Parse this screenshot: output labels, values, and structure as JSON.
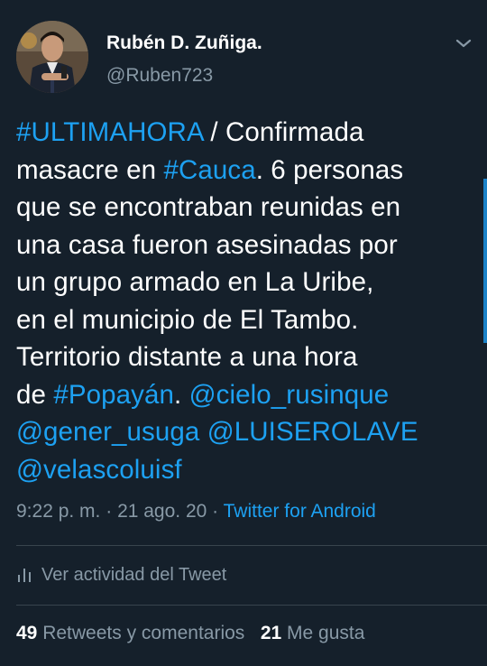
{
  "author": {
    "display_name": "Rubén D. Zuñiga.",
    "handle": "@Ruben723",
    "avatar_icon": "profile-photo"
  },
  "menu_icon": "chevron-down-icon",
  "tweet": {
    "lines": [
      [
        {
          "text": "#ULTIMAHORA",
          "link": true
        },
        {
          "text": " / Confirmada",
          "link": false
        }
      ],
      [
        {
          "text": "masacre en ",
          "link": false
        },
        {
          "text": "#Cauca",
          "link": true
        },
        {
          "text": ".  6 personas",
          "link": false
        }
      ],
      [
        {
          "text": "que se encontraban reunidas en",
          "link": false
        }
      ],
      [
        {
          "text": "una casa fueron asesinadas por",
          "link": false
        }
      ],
      [
        {
          "text": "un grupo armado en La Uribe,",
          "link": false
        }
      ],
      [
        {
          "text": "en el municipio de El Tambo.",
          "link": false
        }
      ],
      [
        {
          "text": "Territorio distante a una hora",
          "link": false
        }
      ],
      [
        {
          "text": "de ",
          "link": false
        },
        {
          "text": "#Popayán",
          "link": true
        },
        {
          "text": ". ",
          "link": false
        },
        {
          "text": "@cielo_rusinque",
          "link": true
        }
      ],
      [
        {
          "text": "@gener_usuga",
          "link": true
        },
        {
          "text": " ",
          "link": false
        },
        {
          "text": "@LUISEROLAVE",
          "link": true
        }
      ],
      [
        {
          "text": "@velascoluisf",
          "link": true
        }
      ]
    ]
  },
  "meta": {
    "time": "9:22 p. m.",
    "separator": " · ",
    "date": "21 ago. 20",
    "source": "Twitter for Android"
  },
  "activity": {
    "label": "Ver actividad del Tweet",
    "icon": "bar-chart-icon"
  },
  "stats": {
    "retweets_count": "49",
    "retweets_label": "Retweets y comentarios",
    "likes_count": "21",
    "likes_label": "Me gusta"
  },
  "colors": {
    "background": "#15202b",
    "link": "#1da1f2",
    "secondary_text": "#8899a6",
    "divider": "#38444d"
  }
}
